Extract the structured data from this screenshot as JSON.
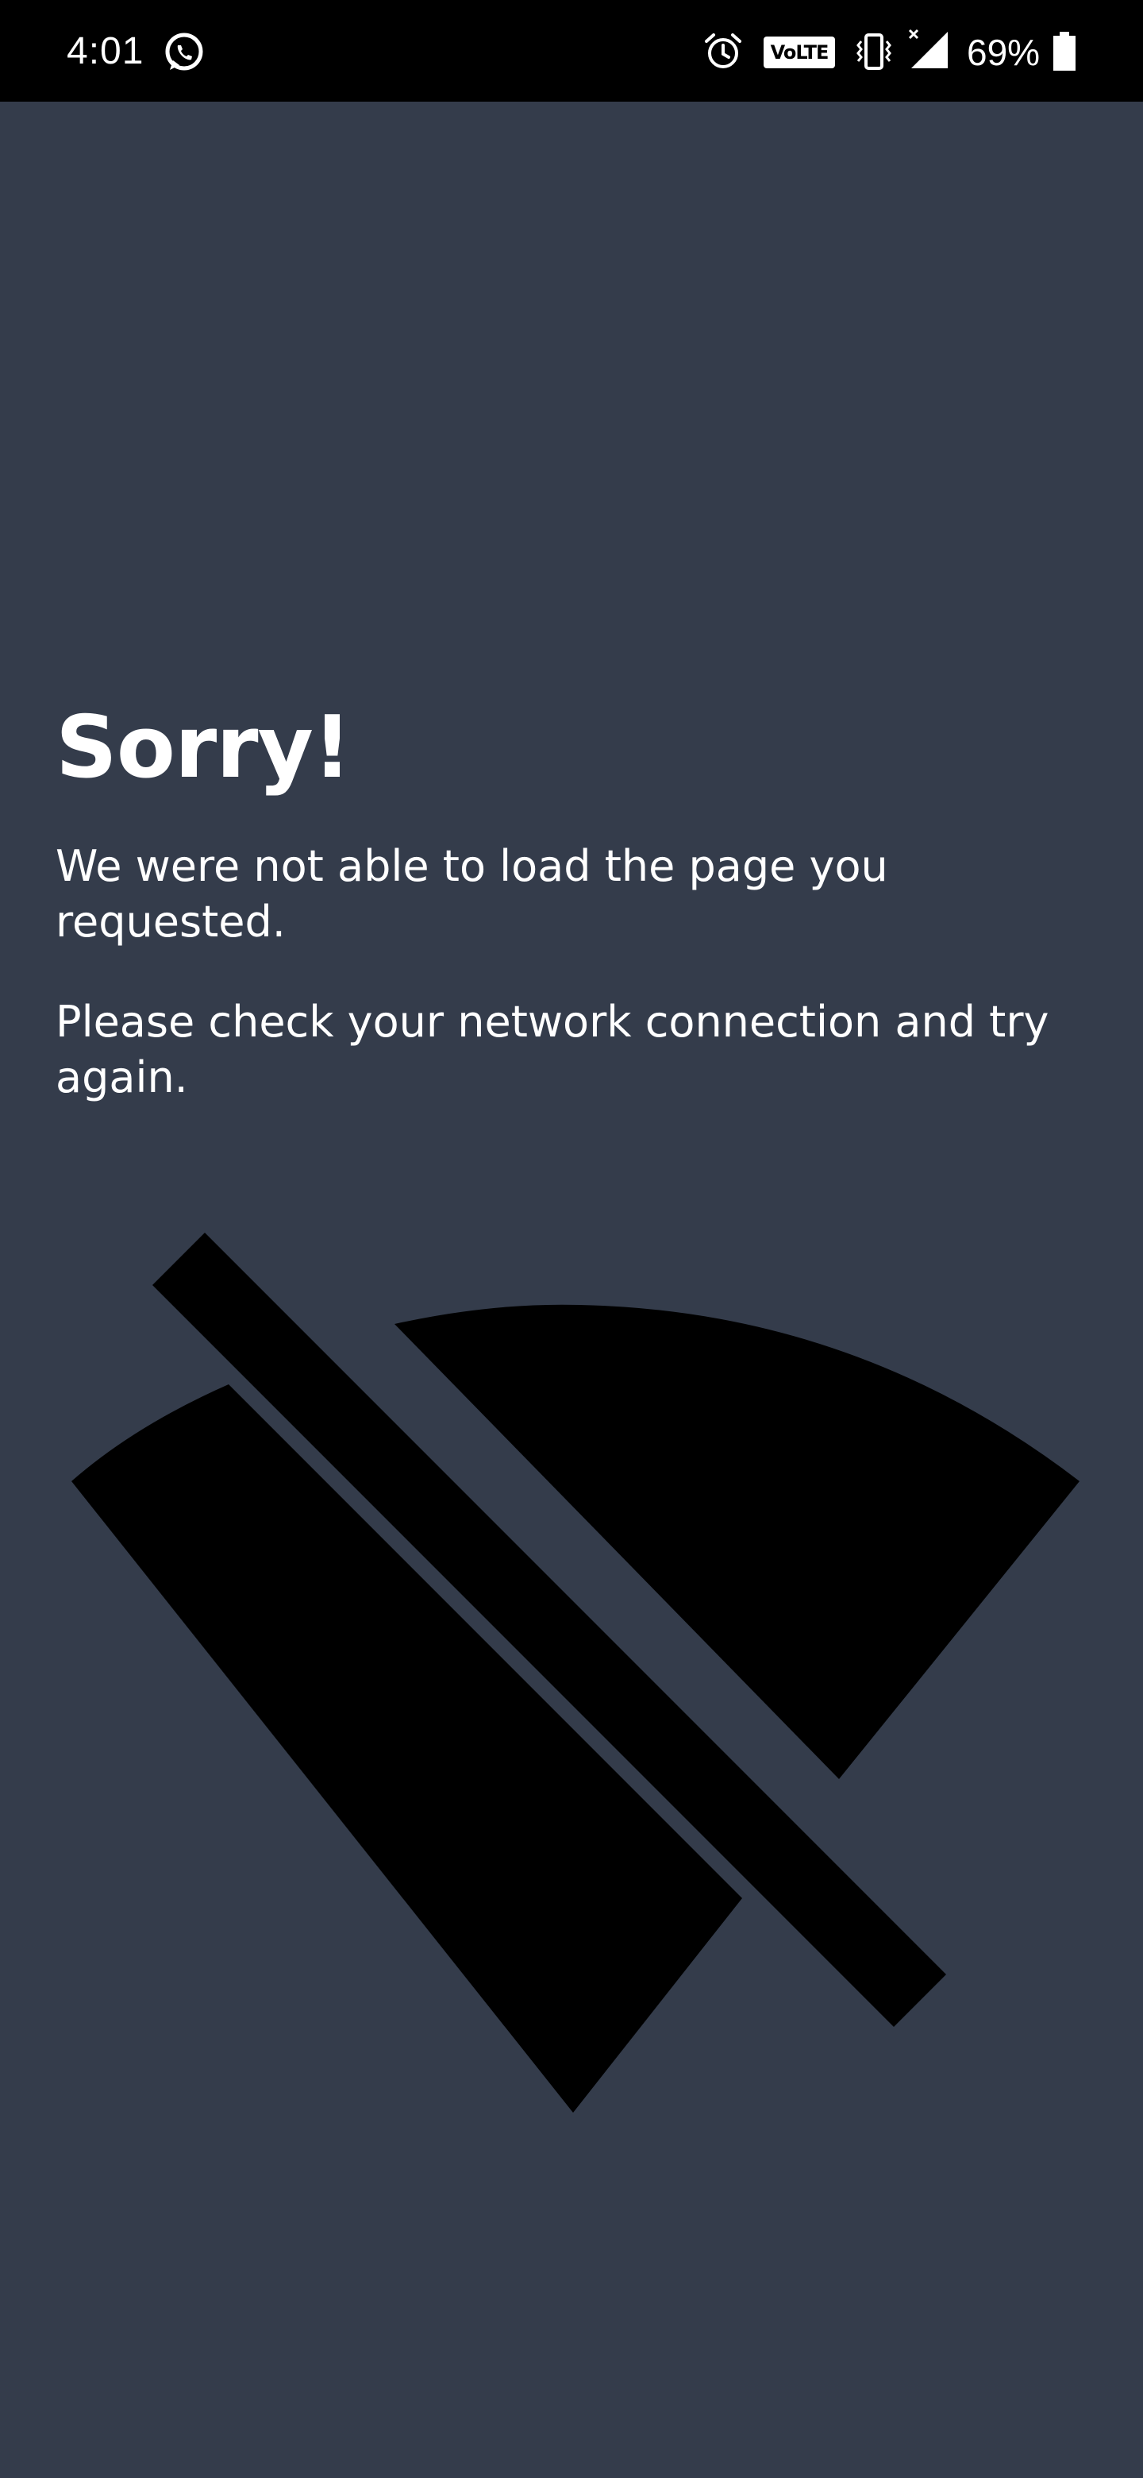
{
  "status_bar": {
    "time": "4:01",
    "volte": "VoLTE",
    "battery_percent": "69%",
    "battery_level": 0.69
  },
  "page": {
    "title": "Sorry!",
    "message_1": "We were not able to load the page you requested.",
    "message_2": "Please check your network connection and try again."
  },
  "colors": {
    "background": "#343c4b",
    "status_bar": "#000000",
    "text": "#ffffff",
    "icon": "#000000"
  },
  "icons": {
    "whatsapp": "whatsapp-icon",
    "alarm": "alarm-icon",
    "vibrate": "vibrate-icon",
    "signal": "signal-icon",
    "battery": "battery-icon",
    "illustration": "wifi-off-icon"
  }
}
